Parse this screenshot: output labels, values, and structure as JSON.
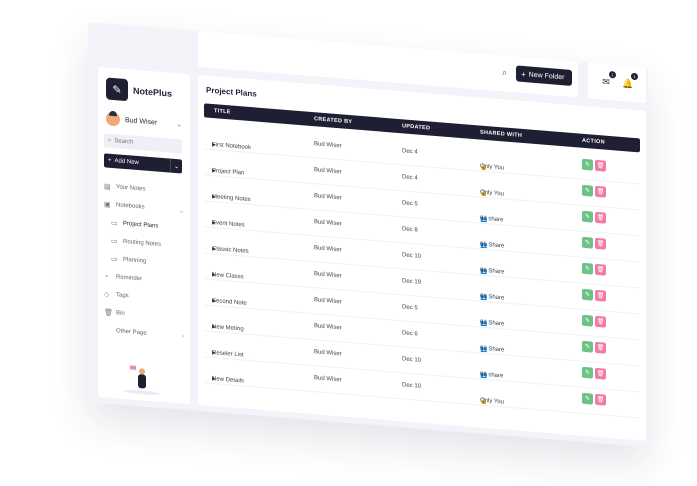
{
  "app": {
    "name": "NotePlus"
  },
  "topbar": {
    "new_folder_label": "New Folder",
    "search_icon": "search-icon",
    "mail_badge": "1",
    "bell_badge": "1"
  },
  "sidebar": {
    "user_name": "Bud Wiser",
    "search_placeholder": "Search",
    "add_new_label": "Add New",
    "items": [
      {
        "label": "Your Notes",
        "icon": "notes-icon"
      },
      {
        "label": "Notebooks",
        "icon": "notebook-icon"
      },
      {
        "label": "Project Plans",
        "icon": "folder-icon"
      },
      {
        "label": "Routing Notes",
        "icon": "folder-icon"
      },
      {
        "label": "Planning",
        "icon": "folder-icon"
      },
      {
        "label": "Reminder",
        "icon": "reminder-icon"
      },
      {
        "label": "Tags",
        "icon": "tag-icon"
      },
      {
        "label": "Bin",
        "icon": "bin-icon"
      },
      {
        "label": "Other Page",
        "icon": ""
      }
    ]
  },
  "main": {
    "title": "Project Plans",
    "columns": [
      "TITLE",
      "CREATED BY",
      "UPDATED",
      "SHARED WITH",
      "ACTION"
    ],
    "rows": [
      {
        "title": "First Notebook",
        "created_by": "Bud Wiser",
        "updated": "Dec 4",
        "shared": "Only You",
        "shared_icon": "lock-icon"
      },
      {
        "title": "Project Plan",
        "created_by": "Bud Wiser",
        "updated": "Dec 4",
        "shared": "Only You",
        "shared_icon": "lock-icon"
      },
      {
        "title": "Meeting Notes",
        "created_by": "Bud Wiser",
        "updated": "Dec 5",
        "shared": "02 share",
        "shared_icon": "users-icon"
      },
      {
        "title": "Event Notes",
        "created_by": "Bud Wiser",
        "updated": "Dec 8",
        "shared": "05 Share",
        "shared_icon": "users-icon"
      },
      {
        "title": "Classic Notes",
        "created_by": "Bud Wiser",
        "updated": "Dec 10",
        "shared": "06 Share",
        "shared_icon": "users-icon"
      },
      {
        "title": "New Classs",
        "created_by": "Bud Wiser",
        "updated": "Dec 19",
        "shared": "08 Share",
        "shared_icon": "users-icon"
      },
      {
        "title": "Second Note",
        "created_by": "Bud Wiser",
        "updated": "Dec 5",
        "shared": "02 Share",
        "shared_icon": "users-icon"
      },
      {
        "title": "New Meting",
        "created_by": "Bud Wiser",
        "updated": "Dec 6",
        "shared": "02 Share",
        "shared_icon": "users-icon"
      },
      {
        "title": "Reseler List",
        "created_by": "Bud Wiser",
        "updated": "Dec 10",
        "shared": "08 share",
        "shared_icon": "users-icon"
      },
      {
        "title": "New Details",
        "created_by": "Bud Wiser",
        "updated": "Dec 10",
        "shared": "Only You",
        "shared_icon": "lock-icon"
      }
    ]
  },
  "colors": {
    "primary": "#1f1f33",
    "edit_button": "#6cc287",
    "delete_button": "#f27aa8",
    "background": "#f3f4f9"
  }
}
